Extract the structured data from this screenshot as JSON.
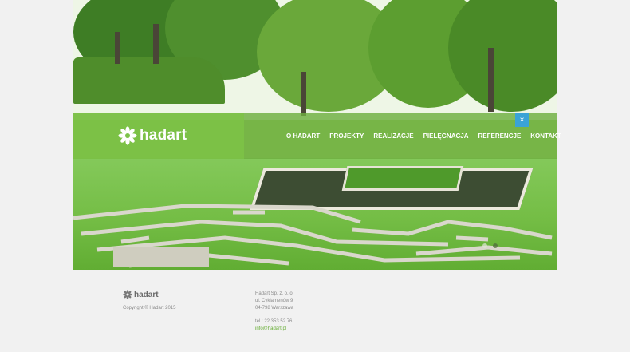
{
  "header": {
    "brand": "hadart",
    "nav": [
      "O HADART",
      "PROJEKTY",
      "REALIZACJE",
      "PIELĘGNACJA",
      "REFERENCJE",
      "KONTAKT"
    ],
    "close_label": "×"
  },
  "hero": {
    "icons": {
      "logo": "flower-icon",
      "close": "close-icon"
    },
    "slides": 2,
    "active_slide": 2
  },
  "footer": {
    "brand": "hadart",
    "copyright": "Copyright © Hadart 2015",
    "company": "Hadart Sp. z. o. o.",
    "street": "ul. Cyklamenów 9",
    "city": "04-798 Warszawa",
    "phone": "tel.: 22 353 52 76",
    "email": "info@hadart.pl"
  },
  "colors": {
    "accent": "#6caf3e",
    "close_button": "#3aa3d6",
    "email": "#66ad34",
    "background": "#f1f1f1"
  }
}
